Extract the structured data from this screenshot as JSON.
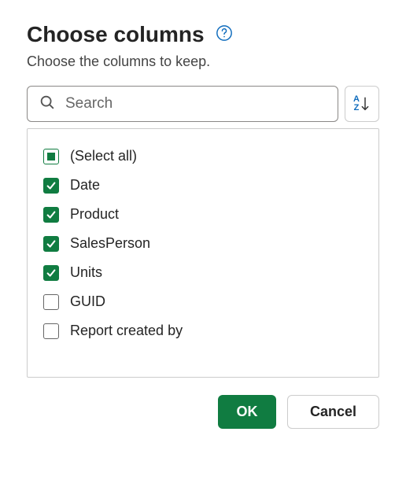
{
  "dialog": {
    "title": "Choose columns",
    "subtitle": "Choose the columns to keep."
  },
  "search": {
    "placeholder": "Search",
    "value": ""
  },
  "columns": {
    "select_all_label": "(Select all)",
    "select_all_state": "indeterminate",
    "items": [
      {
        "label": "Date",
        "checked": true
      },
      {
        "label": "Product",
        "checked": true
      },
      {
        "label": "SalesPerson",
        "checked": true
      },
      {
        "label": "Units",
        "checked": true
      },
      {
        "label": "GUID",
        "checked": false
      },
      {
        "label": "Report created by",
        "checked": false
      }
    ]
  },
  "buttons": {
    "ok": "OK",
    "cancel": "Cancel"
  },
  "colors": {
    "primary": "#107c41",
    "link": "#0f6cbd"
  }
}
